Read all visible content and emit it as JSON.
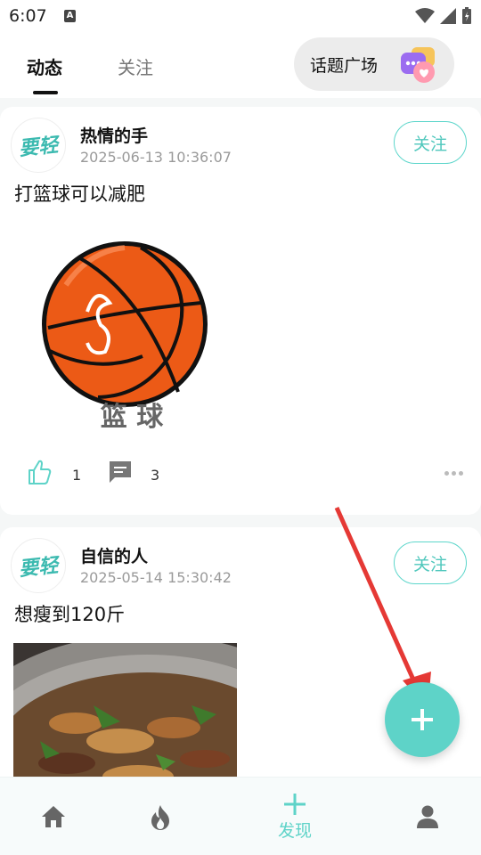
{
  "status_bar": {
    "time": "6:07",
    "badge": "A"
  },
  "header": {
    "tabs": [
      {
        "label": "动态",
        "active": true
      },
      {
        "label": "关注",
        "active": false
      }
    ],
    "topic_button": "话题广场"
  },
  "posts": [
    {
      "avatar_text": "要轻",
      "user": "热情的手",
      "time": "2025-06-13 10:36:07",
      "follow_label": "关注",
      "text": "打篮球可以减肥",
      "image_caption": "篮 球",
      "likes": "1",
      "comments": "3"
    },
    {
      "avatar_text": "要轻",
      "user": "自信的人",
      "time": "2025-05-14 15:30:42",
      "follow_label": "关注",
      "text": "想瘦到120斤"
    }
  ],
  "fab": {
    "icon": "plus-icon"
  },
  "bottom_nav": {
    "items": [
      {
        "icon": "home-icon",
        "label": ""
      },
      {
        "icon": "fire-icon",
        "label": ""
      },
      {
        "icon": "plus-icon",
        "label": "发现",
        "active": true
      },
      {
        "icon": "person-icon",
        "label": ""
      }
    ]
  },
  "colors": {
    "accent": "#5ed3c8",
    "arrow": "#e53935",
    "basketball": "#ec5a16"
  }
}
